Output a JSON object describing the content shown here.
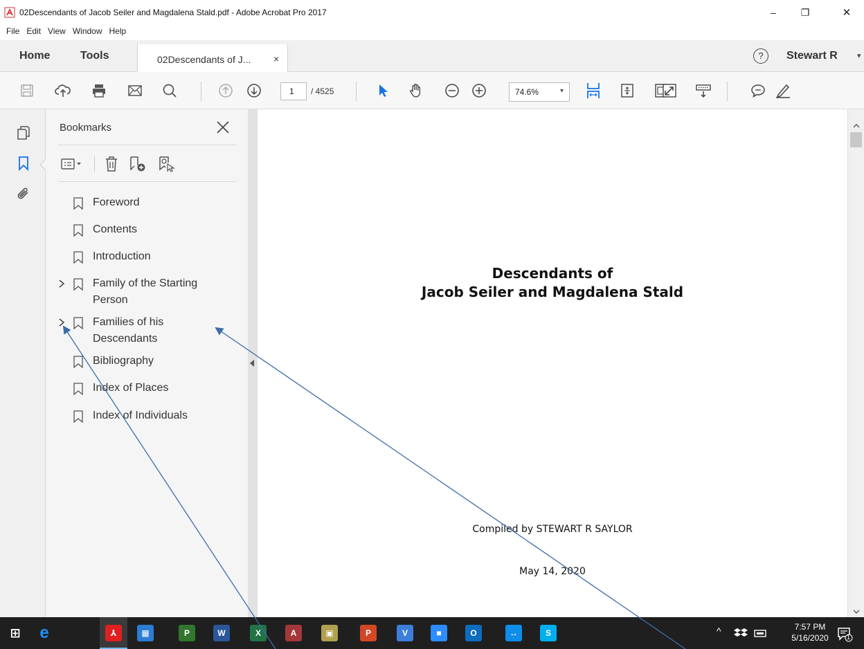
{
  "window": {
    "title": "02Descendants of Jacob Seiler and Magdalena Stald.pdf - Adobe Acrobat Pro 2017",
    "minimize_glyph": "–",
    "restore_glyph": "❐",
    "close_glyph": "✕"
  },
  "menu": [
    "File",
    "Edit",
    "View",
    "Window",
    "Help"
  ],
  "tabs": {
    "home": "Home",
    "tools": "Tools",
    "document": "02Descendants of J...",
    "document_close": "×",
    "help_glyph": "?",
    "user": "Stewart R",
    "user_arrow": "▾"
  },
  "toolbar": {
    "page_current": "1",
    "page_total": "/ 4525",
    "zoom": "74.6%",
    "zoom_arrow": "▾"
  },
  "bookmarks": {
    "header": "Bookmarks",
    "items": [
      {
        "label": "Foreword"
      },
      {
        "label": "Contents"
      },
      {
        "label": "Introduction"
      },
      {
        "label_line1": "Family of the Starting",
        "label_line2": "Person"
      },
      {
        "label_line1": "Families of his",
        "label_line2": "Descendants"
      },
      {
        "label": "Bibliography"
      },
      {
        "label": "Index of Places"
      },
      {
        "label": "Index of Individuals"
      }
    ]
  },
  "document": {
    "title_line1": "Descendants of",
    "title_line2": "Jacob Seiler and Magdalena Stald",
    "compiled_by": "Compiled by STEWART R SAYLOR",
    "date": "May 14, 2020"
  },
  "taskbar": {
    "apps": [
      {
        "icon": "windows-start-icon",
        "glyph": "⊞",
        "color": "#ffffff"
      },
      {
        "icon": "edge-icon",
        "glyph": "e",
        "color": "#1e90ff"
      },
      {
        "icon": "acrobat-icon",
        "glyph": "⅄",
        "color": "#e02020"
      },
      {
        "icon": "outlook-contacts-icon",
        "glyph": "▦",
        "color": "#2b7cd3"
      },
      {
        "icon": "project-icon",
        "glyph": "P",
        "color": "#31752f"
      },
      {
        "icon": "word-icon",
        "glyph": "W",
        "color": "#2b579a"
      },
      {
        "icon": "excel-icon",
        "glyph": "X",
        "color": "#217346"
      },
      {
        "icon": "access-icon",
        "glyph": "A",
        "color": "#a4373a"
      },
      {
        "icon": "publisher-icon",
        "glyph": "▣",
        "color": "#b0a050"
      },
      {
        "icon": "powerpoint-icon",
        "glyph": "P",
        "color": "#d24726"
      },
      {
        "icon": "visual-studio-code-icon",
        "glyph": "V",
        "color": "#3c7fd9"
      },
      {
        "icon": "zoom-icon",
        "glyph": "■",
        "color": "#2d8cff"
      },
      {
        "icon": "outlook-icon",
        "glyph": "O",
        "color": "#0f6cbd"
      },
      {
        "icon": "teamviewer-icon",
        "glyph": "↔",
        "color": "#0e8ee9"
      },
      {
        "icon": "skype-icon",
        "glyph": "S",
        "color": "#00aff0"
      }
    ],
    "tray_caret": "^",
    "time": "7:57 PM",
    "date": "5/16/2020",
    "notification_count": "1"
  },
  "colors": {
    "accent_blue": "#1473e6",
    "arrow_color": "#3c6ea8"
  }
}
